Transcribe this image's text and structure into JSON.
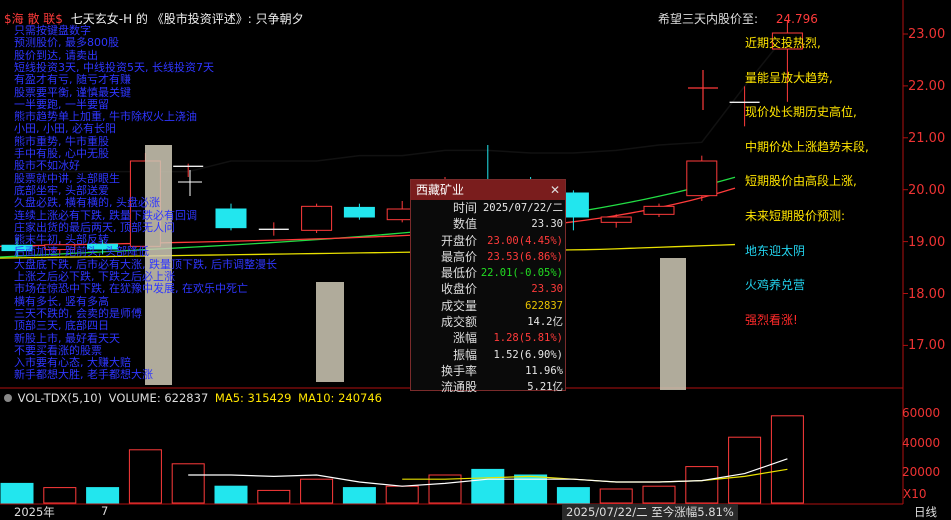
{
  "header": {
    "brand": "$海 散 联$",
    "title": "七天玄女-H 的 《股市投资评述》: 只争朝夕",
    "target_label": "希望三天内股价至:",
    "target_value": "24.796"
  },
  "price_axis": [
    "23.00",
    "22.00",
    "21.00",
    "20.00",
    "19.00",
    "18.00",
    "17.00"
  ],
  "vol_axis": [
    "60000",
    "40000",
    "20000"
  ],
  "vol_unit": "X10",
  "right_notes": [
    {
      "text": "近期交投热烈,",
      "color": "#ffe500"
    },
    {
      "text": "量能呈放大趋势,",
      "color": "#ffe500"
    },
    {
      "text": "现价处长期历史高位,",
      "color": "#ffe500"
    },
    {
      "text": "中期价处上涨趋势末段,",
      "color": "#ffe500"
    },
    {
      "text": "短期股价由高段上涨,",
      "color": "#ffe500"
    },
    {
      "text": "未来短期股价预测:",
      "color": "#ffe500"
    },
    {
      "text": "地东迎太阴",
      "color": "#22d3ee"
    },
    {
      "text": "火鸡养兑营",
      "color": "#22d3ee"
    },
    {
      "text": "强烈看涨!",
      "color": "#ff2a2a"
    }
  ],
  "left_texts": [
    "只需按键盘数字",
    "预测股价, 最多800股",
    "股价到达, 请卖出",
    "短线投资3天, 中线投资5天, 长线投资7天",
    "有盈才有亏, 随亏才有赚",
    "股票要平衡, 谨慎最关键",
    "一半要跑, 一半要留",
    "熊市趋势单上加重, 牛市除权火上浇油",
    "小田, 小田, 必有长阳",
    "熊市重势, 牛市重股",
    "手中有股, 心中无股",
    "股市不如冰好",
    "股票就中讲, 头部眼生",
    "底部坐牢, 头部送爱",
    "久盘必跌, 横有横的, 头盘必涨",
    "连续上涨必有下跌, 跌量下跌必有回调",
    "庄家出货的最后两天, 顶部无人问",
    "熊末牛初, 头部反转",
    "后面加速, 跑前头, 头部降低",
    "大盘底下跌, 后市必有大涨, 跌量顶下跌, 后市调整漫长",
    "上涨之后必下跌, 下跌之后必上涨",
    "市场在惊恐中下跌, 在犹豫中发展, 在欢乐中死亡",
    "横有多长, 竖有多高",
    "三天不跌的, 会卖的是师傅",
    "顶部三天, 底部四日",
    "新股上市, 最好看天天",
    "不要买看涨的股票",
    "入市要有心态, 大赚大赔",
    "新手都想大胜, 老手都想大涨"
  ],
  "popup": {
    "title": "西藏矿业",
    "close": "✕",
    "rows": [
      {
        "k": "时间",
        "v": "2025/07/22/二",
        "color": "#e6e6e6"
      },
      {
        "k": "数值",
        "v": "23.30",
        "color": "#e6e6e6"
      },
      {
        "k": "开盘价",
        "v": "23.00(4.45%)",
        "color": "#ff3b3b"
      },
      {
        "k": "最高价",
        "v": "23.53(6.86%)",
        "color": "#ff3b3b"
      },
      {
        "k": "最低价",
        "v": "22.01(-0.05%)",
        "color": "#22dd22"
      },
      {
        "k": "收盘价",
        "v": "23.30",
        "color": "#ff3b3b"
      },
      {
        "k": "成交量",
        "v": "622837",
        "color": "#e8c200"
      },
      {
        "k": "成交额",
        "v": "14.2亿",
        "color": "#e6e6e6"
      },
      {
        "k": "涨幅",
        "v": "1.28(5.81%)",
        "color": "#ff3b3b"
      },
      {
        "k": "振幅",
        "v": "1.52(6.90%)",
        "color": "#e6e6e6"
      },
      {
        "k": "换手率",
        "v": "11.96%",
        "color": "#e6e6e6"
      },
      {
        "k": "流通股",
        "v": "5.21亿",
        "color": "#e6e6e6"
      }
    ]
  },
  "vol_header": {
    "label": "VOL-TDX(5,10)",
    "volume": "VOLUME: 622837",
    "ma5": "MA5: 315429",
    "ma10": "MA10: 240746"
  },
  "bottom": {
    "year": "2025年",
    "month": "7",
    "date_info": "2025/07/22/二  至今涨幅5.81%",
    "period": "日线"
  },
  "colors": {
    "up": "#ff3b3b",
    "down": "#22e6ee",
    "ma5": "#ffffff",
    "ma10": "#e8e000",
    "ma20": "#ff3b3b",
    "ma30": "#22dd44",
    "ma60": "#e8e000"
  },
  "chart_data": {
    "type": "candlestick",
    "price_range": [
      16.7,
      23.6
    ],
    "candles": [
      {
        "o": 19.32,
        "c": 19.22,
        "h": 19.45,
        "l": 19.1
      },
      {
        "o": 19.24,
        "c": 19.33,
        "h": 19.4,
        "l": 19.15
      },
      {
        "o": 19.34,
        "c": 19.25,
        "h": 19.42,
        "l": 19.15
      },
      {
        "o": 19.3,
        "c": 20.9,
        "h": 21.05,
        "l": 19.3
      },
      {
        "o": 20.8,
        "c": 20.8,
        "h": 20.85,
        "l": 20.6
      },
      {
        "o": 20.0,
        "c": 19.65,
        "h": 20.1,
        "l": 19.6
      },
      {
        "o": 19.62,
        "c": 19.62,
        "h": 19.75,
        "l": 19.5
      },
      {
        "o": 19.6,
        "c": 20.05,
        "h": 20.1,
        "l": 19.55
      },
      {
        "o": 20.03,
        "c": 19.85,
        "h": 20.1,
        "l": 19.8
      },
      {
        "o": 19.8,
        "c": 20.0,
        "h": 20.15,
        "l": 19.75
      },
      {
        "o": 20.2,
        "c": 20.42,
        "h": 20.6,
        "l": 20.15
      },
      {
        "o": 20.55,
        "c": 20.45,
        "h": 21.2,
        "l": 20.35
      },
      {
        "o": 20.42,
        "c": 20.32,
        "h": 20.6,
        "l": 20.2
      },
      {
        "o": 20.3,
        "c": 19.85,
        "h": 20.35,
        "l": 19.6
      },
      {
        "o": 19.75,
        "c": 19.85,
        "h": 19.9,
        "l": 19.65
      },
      {
        "o": 19.9,
        "c": 20.05,
        "h": 20.1,
        "l": 19.85
      },
      {
        "o": 20.25,
        "c": 20.9,
        "h": 21.0,
        "l": 20.15
      },
      {
        "o": 22.0,
        "c": 22.0,
        "h": 22.3,
        "l": 21.55
      },
      {
        "o": 23.0,
        "c": 23.3,
        "h": 23.53,
        "l": 22.01
      }
    ],
    "ma_black": [
      20.7,
      20.7,
      20.7,
      20.7,
      20.7,
      20.9,
      20.9,
      20.9,
      21.0,
      21.0,
      21.1,
      21.1,
      21.05,
      21.05,
      21.1,
      21.2,
      21.25,
      22.3,
      23.3
    ],
    "volumes": [
      14000,
      11000,
      11000,
      38000,
      28000,
      12000,
      9000,
      17000,
      11000,
      12000,
      20000,
      24000,
      20000,
      11000,
      10000,
      12000,
      26000,
      47000,
      62283
    ],
    "vol_ma5": [
      null,
      null,
      null,
      null,
      20000,
      20000,
      19000,
      20000,
      15000,
      12000,
      14000,
      17000,
      17000,
      17000,
      15000,
      15000,
      16000,
      21000,
      31543
    ],
    "vol_ma10": [
      null,
      null,
      null,
      null,
      null,
      null,
      null,
      null,
      null,
      17000,
      17000,
      18000,
      19000,
      17000,
      15000,
      15000,
      16000,
      19000,
      24075
    ]
  }
}
